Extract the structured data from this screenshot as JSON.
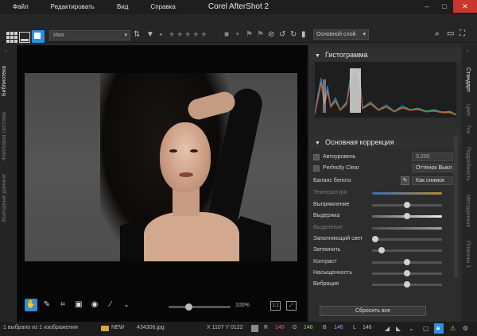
{
  "titlebar": {
    "title": "Corel AfterShot 2",
    "menu": [
      "Файл",
      "Редактировать",
      "Вид",
      "Справка"
    ],
    "controls": [
      "–",
      "□",
      "✕"
    ]
  },
  "toolbar": {
    "sort_value": "Имя",
    "layer_value": "Основной слой"
  },
  "left_tabs": [
    "Библиотека",
    "Файловая система",
    "Выходные данные"
  ],
  "right_tabs": [
    "Стандарт",
    "Цвет",
    "Тон",
    "Подробность",
    "Метаданные",
    "Плагины 1"
  ],
  "viewer": {
    "zoom_label": "100%",
    "zoom_level": 0.3,
    "fit_button": "1:1"
  },
  "panel": {
    "histogram_title": "Гистограмма",
    "correction_title": "Основная коррекция",
    "auto_level_label": "Автоуровень",
    "auto_level_value": "0,200",
    "perfectly_clear_label": "Perfectly Clear",
    "tone_button": "Оттенок Выкл",
    "white_balance_label": "Баланс белого",
    "white_balance_value": "Как снимок",
    "temperature_label": "Температура",
    "straighten_label": "Выпрямление",
    "exposure_label": "Выдержка",
    "highlight_label": "Выделение",
    "fill_light_label": "Заполняющий свет",
    "darken_label": "Затемнить",
    "contrast_label": "Контраст",
    "saturation_label": "Насыщенность",
    "vibrance_label": "Вибрация",
    "reset_button": "Сбросить все"
  },
  "status": {
    "selection": "1 выбрано из 1 изображения",
    "folder": "NEW",
    "file": "434306.jpg",
    "coords": "X 1107  Y 0122",
    "r_label": "R",
    "r_value": "146",
    "g_label": "G",
    "g_value": "146",
    "b_label": "B",
    "b_value": "146",
    "l_label": "L",
    "l_value": "146"
  }
}
